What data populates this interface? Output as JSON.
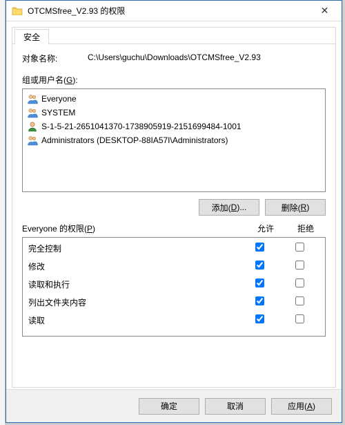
{
  "titlebar": {
    "title": "OTCMSfree_V2.93 的权限",
    "close_symbol": "✕"
  },
  "tab": {
    "security": "安全"
  },
  "object": {
    "label": "对象名称:",
    "path": "C:\\Users\\guchu\\Downloads\\OTCMSfree_V2.93"
  },
  "groups": {
    "label_html": "组或用户名(<u>G</u>):",
    "items": [
      {
        "icon": "group",
        "name": "Everyone"
      },
      {
        "icon": "group",
        "name": "SYSTEM"
      },
      {
        "icon": "user",
        "name": "S-1-5-21-2651041370-1738905919-2151699484-1001"
      },
      {
        "icon": "group",
        "name": "Administrators (DESKTOP-88IA57I\\Administrators)"
      }
    ]
  },
  "buttons": {
    "add_html": "添加(<u>D</u>)...",
    "remove_html": "删除(<u>R</u>)"
  },
  "perms": {
    "label_html": "Everyone 的权限(<u>P</u>)",
    "col_allow": "允许",
    "col_deny": "拒绝",
    "rows": [
      {
        "name": "完全控制",
        "allow": true,
        "deny": false
      },
      {
        "name": "修改",
        "allow": true,
        "deny": false
      },
      {
        "name": "读取和执行",
        "allow": true,
        "deny": false
      },
      {
        "name": "列出文件夹内容",
        "allow": true,
        "deny": false
      },
      {
        "name": "读取",
        "allow": true,
        "deny": false
      }
    ]
  },
  "footer": {
    "ok": "确定",
    "cancel": "取消",
    "apply_html": "应用(<u>A</u>)"
  }
}
